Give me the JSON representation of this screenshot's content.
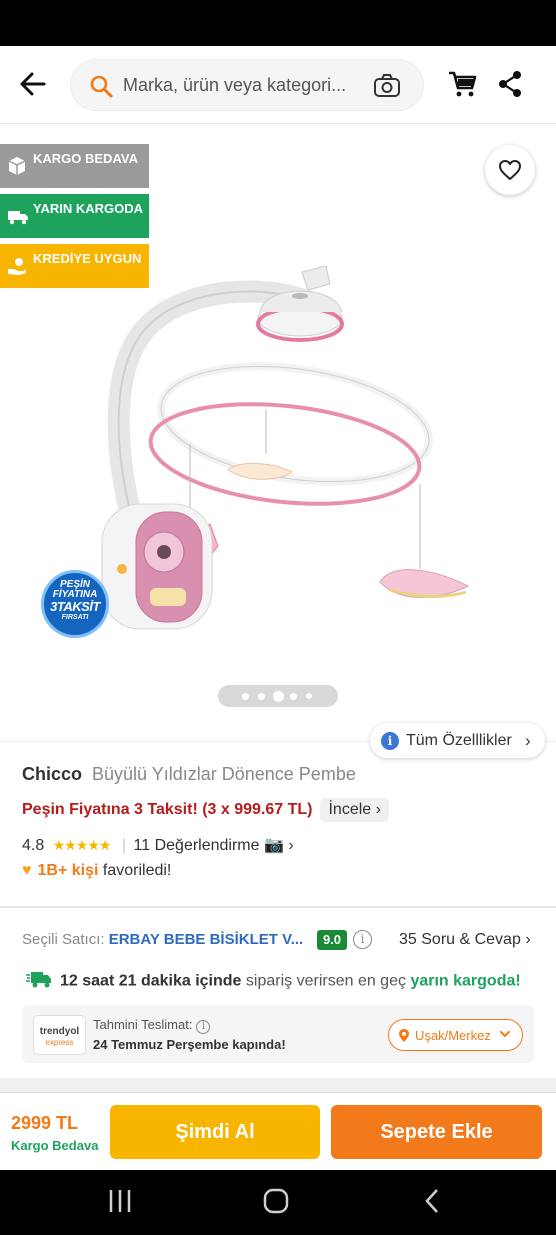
{
  "header": {
    "search_placeholder": "Marka, ürün veya kategori..."
  },
  "badges": {
    "kargo": "KARGO BEDAVA",
    "yarin": "YARIN KARGODA",
    "krediye": "KREDİYE UYGUN"
  },
  "promo_badge": {
    "line1": "PEŞİN",
    "line2": "FİYATINA",
    "line3": "3TAKSİT",
    "line4": "FIRSATI"
  },
  "gallery": {
    "dot_count": 5,
    "active_dot": 2
  },
  "specs_button": {
    "label": "Tüm Özelllikler"
  },
  "product": {
    "brand": "Chicco",
    "name": "Büyülü Yıldızlar Dönence Pembe",
    "installment_text": "Peşin Fiyatına 3 Taksit! (3 x 999.67 TL)",
    "installment_link": "İncele",
    "rating": "4.8",
    "stars": "★★★★★",
    "review_count": "11 Değerlendirme",
    "fav_count": "1B+ kişi",
    "fav_text": "favoriledi!"
  },
  "seller": {
    "label": "Seçili Satıcı:",
    "name": "ERBAY BEBE BİSİKLET V...",
    "score": "9.0",
    "qa": "35 Soru & Cevap"
  },
  "delivery": {
    "time_bold": "12 saat 21 dakika içinde",
    "middle": "sipariş verirsen en geç",
    "highlight": "yarın kargoda!"
  },
  "estimate": {
    "logo_main": "trendyol",
    "logo_sub": "express",
    "label": "Tahmini Teslimat:",
    "date": "24 Temmuz Perşembe kapında!",
    "location": "Uşak/Merkez"
  },
  "bottom": {
    "price": "2999 TL",
    "shipping": "Kargo Bedava",
    "buy_now": "Şimdi Al",
    "add_to_cart": "Sepete Ekle"
  },
  "colors": {
    "brand_orange": "#f27a1a",
    "buy_yellow": "#f8b500",
    "green": "#1ea35c",
    "installment_red": "#b71c1c",
    "seller_blue": "#2e6bbf"
  }
}
